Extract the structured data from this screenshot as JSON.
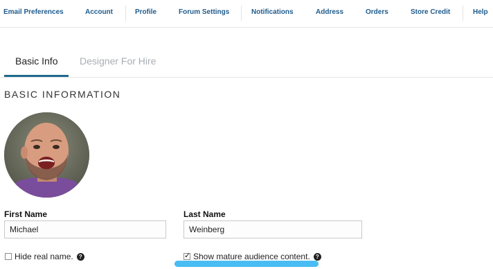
{
  "top_nav": {
    "items": [
      "Email Preferences",
      "Account",
      "Profile",
      "Forum Settings",
      "Notifications",
      "Address",
      "Orders",
      "Store Credit",
      "Help"
    ]
  },
  "tabs": {
    "items": [
      "Basic Info",
      "Designer For Hire"
    ],
    "active": "Basic Info"
  },
  "section": {
    "title": "BASIC INFORMATION"
  },
  "form": {
    "first_name_label": "First Name",
    "first_name_value": "Michael",
    "last_name_label": "Last Name",
    "last_name_value": "Weinberg",
    "hide_real_name_label": "Hide real name.",
    "hide_real_name_checked": false,
    "mature_content_label": "Show mature audience content.",
    "mature_content_checked": true
  },
  "colors": {
    "nav_link": "#1f5b8c",
    "tab_underline": "#1e6a8e",
    "highlight": "#35b6f2"
  }
}
